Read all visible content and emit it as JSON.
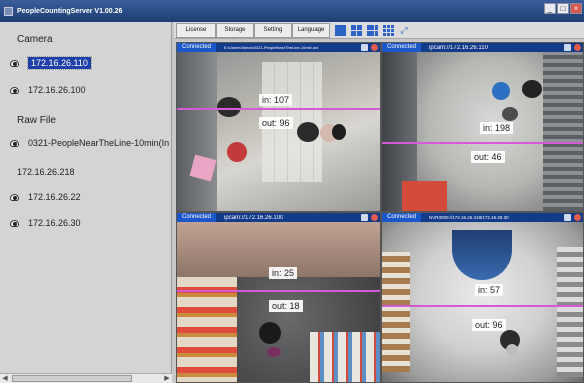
{
  "window": {
    "title": "PeopleCountingServer V1.00.26",
    "controls": [
      "_",
      "□",
      "×"
    ]
  },
  "sidebar": {
    "camera_heading": "Camera",
    "cameras": [
      {
        "label": "172.16.26.110",
        "selected": true
      },
      {
        "label": "172.16.26.100",
        "selected": false
      }
    ],
    "rawfile_heading": "Raw File",
    "raw_files": [
      {
        "label": "0321-PeopleNearTheLine-10min(In"
      }
    ],
    "group_heading": "172.16.26.218",
    "group_cameras": [
      {
        "label": "172.16.26.22"
      },
      {
        "label": "172.16.26.30"
      }
    ]
  },
  "toolbar": {
    "buttons": [
      "License",
      "Storage",
      "Setting",
      "Language"
    ],
    "layout_icons": [
      "layout-1x1-icon",
      "layout-2x2-icon",
      "layout-3x3-icon",
      "layout-4x4-icon",
      "fullscreen-icon"
    ],
    "accent": "#2d62c8"
  },
  "panes": [
    {
      "status": "Connected",
      "address": "E:\\Users\\Videos\\0321-PeopleNearTheLine-10min.avi",
      "in_label": "in: 107",
      "out_label": "out: 96"
    },
    {
      "status": "Connected",
      "address": "ipcam://172.16.26.110",
      "in_label": "in: 198",
      "out_label": "out: 46"
    },
    {
      "status": "Connected",
      "address": "ipcam://172.16.26.100",
      "in_label": "in: 25",
      "out_label": "out: 18"
    },
    {
      "status": "Connected",
      "address": "NVR3000://172.16.26.218/172.16.26.30",
      "in_label": "in: 57",
      "out_label": "out: 96"
    }
  ],
  "colors": {
    "header": "#123b8a",
    "line": "#d35bd6",
    "selection": "#1f3fa8"
  }
}
